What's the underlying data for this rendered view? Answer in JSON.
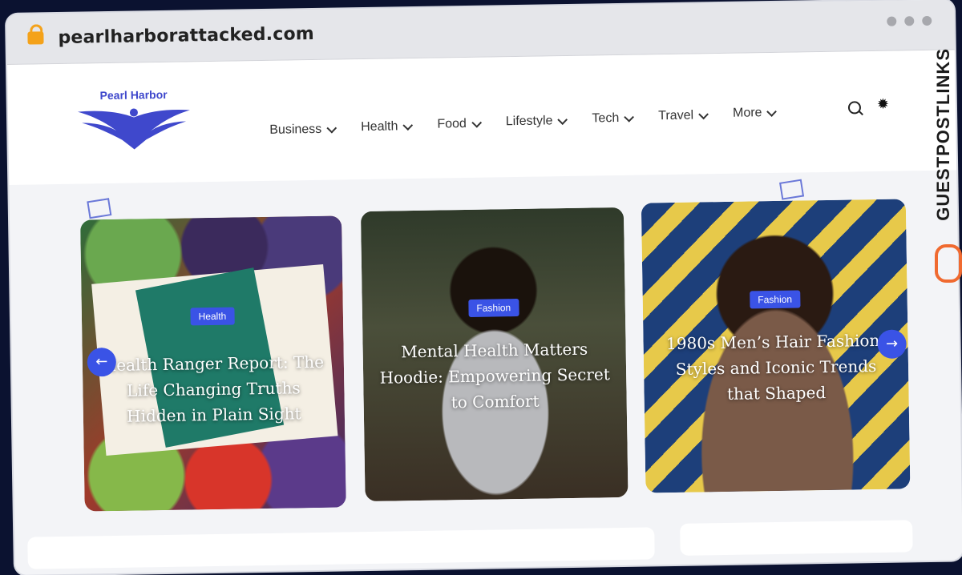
{
  "browser": {
    "url": "pearlharborattacked.com"
  },
  "site": {
    "logo_text": "Pearl Harbor",
    "nav": [
      {
        "label": "Business"
      },
      {
        "label": "Health"
      },
      {
        "label": "Food"
      },
      {
        "label": "Lifestyle"
      },
      {
        "label": "Tech"
      },
      {
        "label": "Travel"
      },
      {
        "label": "More"
      }
    ]
  },
  "slider": {
    "cards": [
      {
        "category": "Health",
        "title": "Health Ranger Report: The Life Changing Truths Hidden in Plain Sight"
      },
      {
        "category": "Fashion",
        "title": "Mental Health Matters Hoodie: Empowering Secret to Comfort"
      },
      {
        "category": "Fashion",
        "title": "1980s Men’s Hair Fashion: Styles and Iconic Trends that Shaped"
      }
    ],
    "prev_icon": "←",
    "next_icon": "→"
  },
  "watermark": {
    "text": "GUESTPOSTLINKS"
  },
  "colors": {
    "accent": "#3a53e6",
    "brand": "#3f48cc",
    "watermark_icon": "#f06a30"
  }
}
